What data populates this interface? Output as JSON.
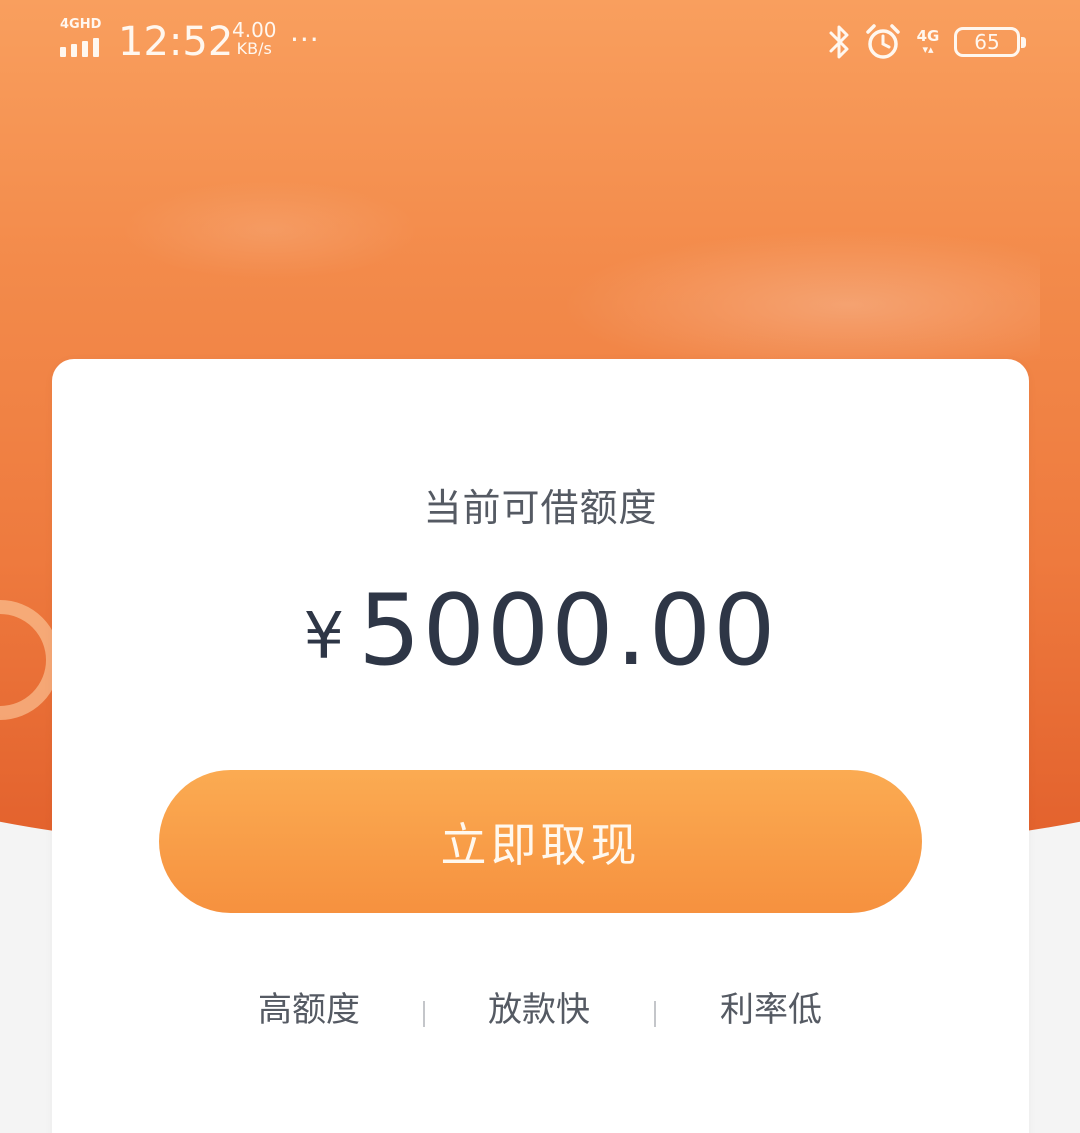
{
  "status_bar": {
    "network_label": "4GHD",
    "time": "12:52",
    "speed_value": "4.00",
    "speed_unit": "KB/s",
    "more_dots": "···",
    "cellular_label": "4G",
    "cellular_arrows": "▾▴",
    "battery_level": "65"
  },
  "card": {
    "label": "当前可借额度",
    "currency": "¥",
    "amount": "5000.00",
    "button_label": "立即取现",
    "features": [
      "高额度",
      "放款快",
      "利率低"
    ]
  },
  "colors": {
    "hero_top": "#f99f5e",
    "hero_bottom": "#e2602c",
    "button": "#f6913f",
    "amount_text": "#2e3646"
  },
  "icons": [
    "signal-icon",
    "bluetooth-icon",
    "alarm-icon",
    "battery-icon"
  ]
}
